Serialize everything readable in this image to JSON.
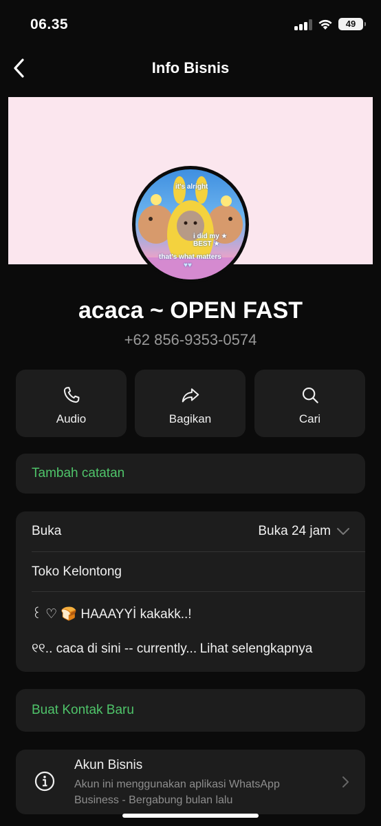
{
  "status_bar": {
    "time": "06.35",
    "battery": "49"
  },
  "nav": {
    "title": "Info Bisnis",
    "back_icon": "chevron-left-icon"
  },
  "profile": {
    "name": "acaca ~ OPEN FAST",
    "phone": "+62 856-9353-0574",
    "cover_color": "#fbe6ee",
    "avatar_text": {
      "top": "it's alright",
      "middle": "i did my ★ BEST ★",
      "bottom": "that's what matters",
      "hearts": "♥♥"
    }
  },
  "actions": [
    {
      "label": "Audio",
      "icon": "phone-icon"
    },
    {
      "label": "Bagikan",
      "icon": "share-icon"
    },
    {
      "label": "Cari",
      "icon": "search-icon"
    }
  ],
  "notes": {
    "add_note": "Tambah catatan"
  },
  "business_info": {
    "hours_label": "Buka",
    "hours_value": "Buka 24 jam",
    "category": "Toko Kelontong",
    "description_line1": "꒰ ♡ 🍞 HAAAYYİ kakakk..!",
    "description_line2": "୧୧.. caca di sini -- currently...",
    "see_more": "Lihat selengkapnya"
  },
  "contact": {
    "new_contact": "Buat Kontak Baru"
  },
  "account": {
    "title": "Akun Bisnis",
    "description": "Akun ini menggunakan aplikasi WhatsApp Business - Bergabung bulan lalu",
    "icon": "info-icon"
  },
  "colors": {
    "accent": "#4fc46a",
    "background": "#0b0b0b",
    "card": "#1d1d1d"
  }
}
